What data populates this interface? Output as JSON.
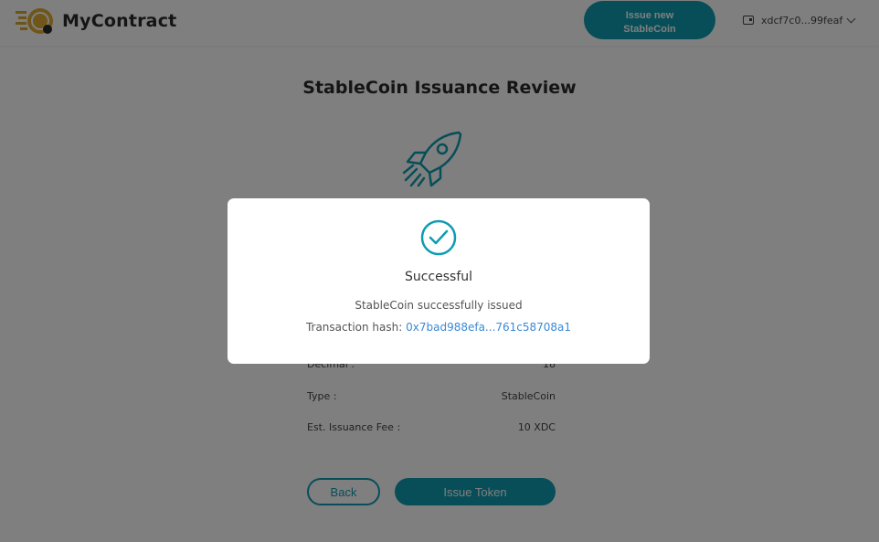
{
  "header": {
    "brand": "MyContract",
    "issue_button_line1": "Issue new",
    "issue_button_line2": "StableCoin",
    "wallet_address": "xdcf7c0...99feaf"
  },
  "page": {
    "title": "StableCoin Issuance Review",
    "details": [
      {
        "label": "Decimal :",
        "value": "18"
      },
      {
        "label": "Type :",
        "value": "StableCoin"
      },
      {
        "label": "Est. Issuance Fee :",
        "value": "10 XDC"
      }
    ],
    "back_label": "Back",
    "issue_token_label": "Issue Token"
  },
  "modal": {
    "title": "Successful",
    "message": "StableCoin successfully issued",
    "hash_label": "Transaction hash:",
    "hash_value": "0x7bad988efa...761c58708a1"
  },
  "colors": {
    "accent": "#0e9cb1",
    "link": "#3a8ad6"
  }
}
